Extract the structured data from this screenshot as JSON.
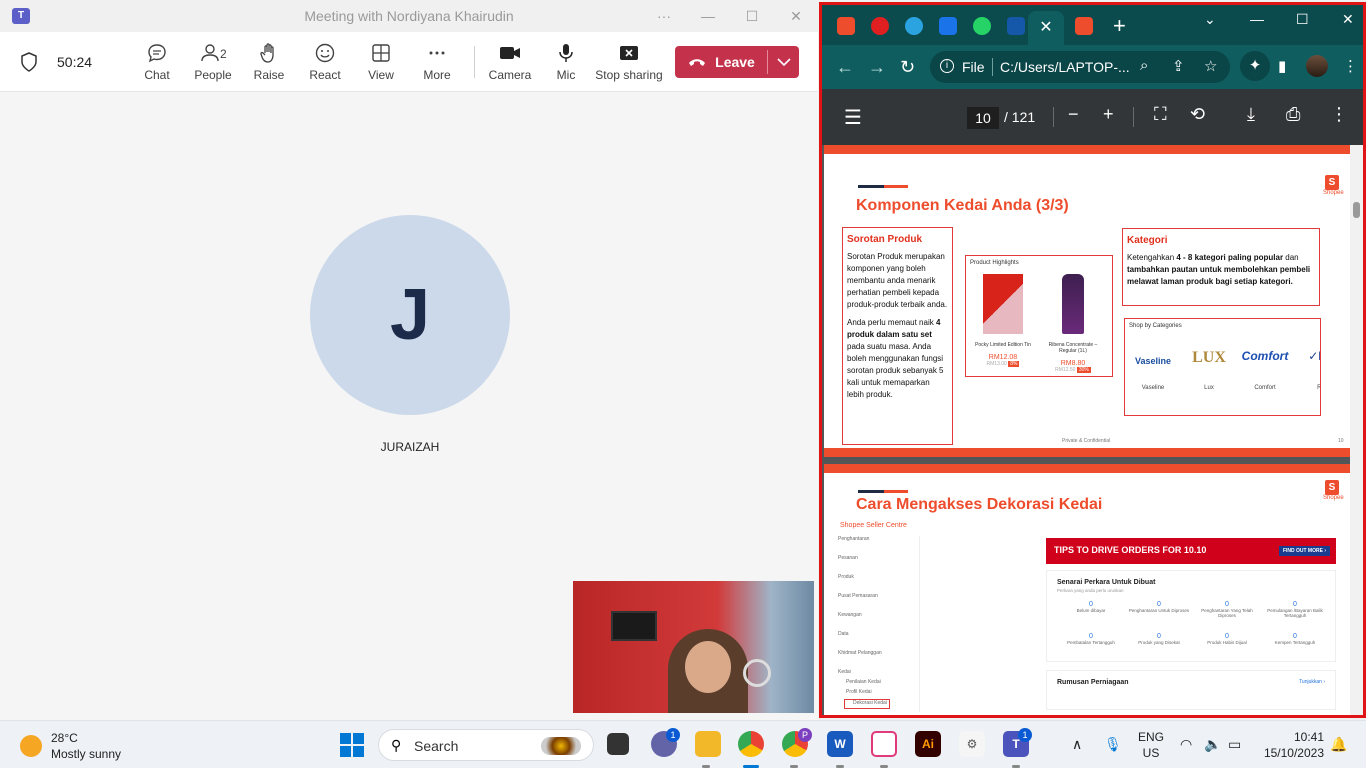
{
  "teams": {
    "window_title": "Meeting with Nordiyana Khairudin",
    "app_logo": "T",
    "timer": "50:24",
    "toolbar": {
      "chat": "Chat",
      "people": "People",
      "people_count": "2",
      "raise": "Raise",
      "react": "React",
      "view": "View",
      "more": "More",
      "camera": "Camera",
      "mic": "Mic",
      "stop_sharing": "Stop sharing",
      "leave": "Leave"
    },
    "participant_initial": "J",
    "participant_name": "JURAIZAH"
  },
  "chrome": {
    "new_tab": "+",
    "address_prefix": "File",
    "address_url": "C:/Users/LAPTOP-...",
    "pdf": {
      "current_page": "10",
      "total_pages": "/ 121"
    }
  },
  "slide10": {
    "title": "Komponen Kedai Anda (3/3)",
    "logo_label": "Shopee",
    "sorotan_heading": "Sorotan Produk",
    "sorotan_p1": "Sorotan Produk merupakan komponen yang boleh membantu anda menarik perhatian pembeli kepada produk-produk terbaik anda.",
    "sorotan_p2a": "Anda perlu memaut naik ",
    "sorotan_p2b": "4 produk dalam satu set",
    "sorotan_p2c": " pada suatu masa. Anda boleh menggunakan fungsi sorotan produk sebanyak 5 kali untuk memaparkan lebih produk.",
    "highlights_title": "Product Highlights",
    "products": [
      {
        "name": "Pocky Limited Edition Tin",
        "price": "RM12.08",
        "old": "RM13.00",
        "disc": "8%"
      },
      {
        "name": "Ribena Concentrate – Regular (1L)",
        "price": "RM8.80",
        "old": "RM12.50",
        "disc": "30%"
      }
    ],
    "kategori_heading": "Kategori",
    "kategori_a": "Ketengahkan ",
    "kategori_b": "4 - 8 kategori paling popular",
    "kategori_c": " dan ",
    "kategori_d": "tambahkan pautan untuk membolehkan pembeli melawat laman produk bagi setiap kategori.",
    "shop_by_categories": "Shop by Categories",
    "brands": [
      "Vaseline",
      "Lux",
      "Comfort",
      "Re"
    ],
    "brand_logos": [
      "Vaseline",
      "LUX",
      "Comfort",
      "✓Re"
    ],
    "footer": "Private & Confidential",
    "page_no": "10"
  },
  "slide11": {
    "title": "Cara Mengakses Dekorasi Kedai",
    "logo_label": "Shopee",
    "seller_centre": "Shopee Seller Centre",
    "sidebar": [
      "Penghantaran",
      "Pesanan",
      "Produk",
      "Pusat Pemasaran",
      "Kewangan",
      "Data",
      "Khidmat Pelanggan",
      "Kedai",
      "Penilaian Kedai",
      "Profil Kedai",
      "Dekorasi Kedai"
    ],
    "banner": "TIPS TO DRIVE ORDERS FOR 10.10",
    "banner_btn": "FIND OUT MORE ›",
    "todo_title": "Senarai Perkara Untuk Dibuat",
    "todo_sub": "Perkara yang anda perlu uruskan",
    "todo": [
      {
        "v": "0",
        "l": "Belum dibayar"
      },
      {
        "v": "0",
        "l": "Penghantaran Untuk Diproses"
      },
      {
        "v": "0",
        "l": "Penghantaran Yang Telah Diproses"
      },
      {
        "v": "0",
        "l": "Pemulangan /Bayaran Balik Tertangguh"
      },
      {
        "v": "0",
        "l": "Pembatalan Tertangguh"
      },
      {
        "v": "0",
        "l": "Produk yang Disekat"
      },
      {
        "v": "0",
        "l": "Produk Habis Dijual"
      },
      {
        "v": "0",
        "l": "Kempen Tertangguh"
      }
    ],
    "business_title": "Rumusan Perniagaan",
    "business_link": "Tunjukkan ›"
  },
  "taskbar": {
    "temp": "28°C",
    "condition": "Mostly sunny",
    "search": "Search",
    "lang1": "ENG",
    "lang2": "US",
    "time": "10:41",
    "date": "15/10/2023",
    "badges": {
      "teams_chat": "1",
      "teams_classic": "1",
      "chrome_profile": "P"
    }
  }
}
